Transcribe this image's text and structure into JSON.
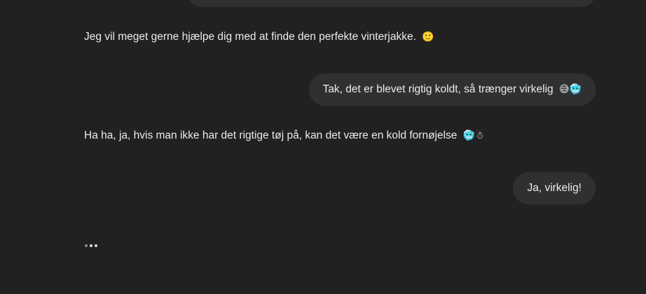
{
  "messages": [
    {
      "role": "assistant",
      "text": "Jeg vil meget gerne hjælpe dig med at finde den perfekte vinterjakke.",
      "emoji": "🙂"
    },
    {
      "role": "user",
      "text": "Tak, det er blevet rigtig koldt, så trænger virkelig",
      "emoji": "😅🥶"
    },
    {
      "role": "assistant",
      "text": "Ha ha, ja, hvis man ikke har det rigtige tøj på, kan det være en kold fornøjelse",
      "emoji": "🥶☃"
    },
    {
      "role": "user",
      "text": "Ja, virkelig!",
      "emoji": ""
    }
  ],
  "typing_indicator": {
    "state": "typing",
    "dots": 3
  }
}
